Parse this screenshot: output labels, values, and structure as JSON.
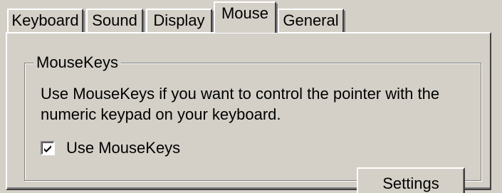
{
  "tabs": [
    {
      "label": "Keyboard",
      "active": false
    },
    {
      "label": "Sound",
      "active": false
    },
    {
      "label": "Display",
      "active": false
    },
    {
      "label": "Mouse",
      "active": true
    },
    {
      "label": "General",
      "active": false
    }
  ],
  "mousekeys": {
    "group_title": "MouseKeys",
    "description": "Use MouseKeys if you want to control the pointer with the numeric keypad on your keyboard.",
    "checkbox_label": "Use MouseKeys",
    "checkbox_checked": true,
    "settings_label": "Settings"
  },
  "icons": {
    "checkbox_mark": "checkmark-icon"
  },
  "colors": {
    "face": "#d4d0c8",
    "highlight": "#ffffff",
    "shadow": "#808080",
    "dark_shadow": "#404040"
  }
}
